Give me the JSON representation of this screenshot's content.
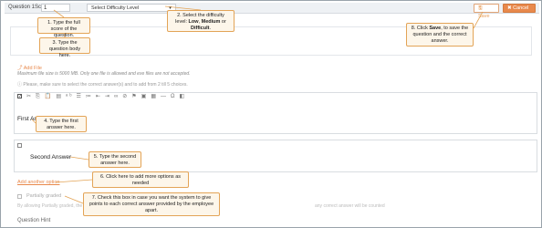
{
  "header": {
    "score_label": "Question 1Score",
    "score_value": "1",
    "difficulty_placeholder": "Select Difficulty Level",
    "save_label": "Save",
    "cancel_label": "Cancel"
  },
  "attachments": {
    "add_file": "Add File",
    "max_size_note": "Maximum file size is 5000 MB. Only one file is allowed and exe files are not accepted.",
    "select_note": "Please, make sure to select the correct answer(s) and to add from 2 till 5 choices."
  },
  "toolbar_icons": [
    "cut-icon",
    "copy-icon",
    "paste-icon",
    "paste-text-icon",
    "spellcheck-icon",
    "numbered-list-icon",
    "bulleted-list-icon",
    "outdent-icon",
    "indent-icon",
    "link-icon",
    "unlink-icon",
    "anchor-icon",
    "image-icon",
    "table-icon",
    "hr-icon",
    "special-char-icon",
    "source-icon"
  ],
  "answers": {
    "first": "First Answer",
    "second": "Second Answer",
    "add_option": "Add another option"
  },
  "partial": {
    "label": "Partially graded",
    "note": "By allowing Partially graded, the",
    "note_tail": "any correct answer will be counted"
  },
  "hint_label": "Question Hint",
  "callouts": {
    "c1": "1. Type the full score of the question.",
    "c2_pre": "2. Select the difficulty level: ",
    "c2_low": "Low",
    "c2_medium": "Medium",
    "c2_or": " or ",
    "c2_difficult": "Difficult",
    "c3": "3. Type the question body here.",
    "c4": "4. Type the first answer here.",
    "c5": "5. Type the second answer here.",
    "c6": "6. Click here to add more options as needed",
    "c7": "7. Check this box in case you want the system to give points to each correct answer provided by the employee apart.",
    "c8_pre": "8. Click ",
    "c8_save": "Save",
    "c8_post": ", to save the question and the correct answer."
  },
  "colors": {
    "accent": "#e8894c",
    "callout_border": "#e3a457",
    "callout_bg": "#fdf6ea"
  }
}
